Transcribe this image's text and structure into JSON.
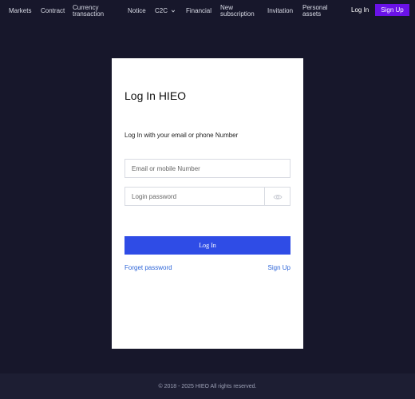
{
  "nav": {
    "items": [
      {
        "label": "Markets"
      },
      {
        "label": "Contract"
      },
      {
        "label": "Currency transaction"
      },
      {
        "label": "Notice"
      },
      {
        "label": "C2C"
      },
      {
        "label": "Financial"
      },
      {
        "label": "New subscription"
      },
      {
        "label": "Invitation"
      },
      {
        "label": "Personal assets"
      }
    ],
    "login": "Log In",
    "signup": "Sign Up"
  },
  "form": {
    "title": "Log In HIEO",
    "subtitle": "Log In with your email or phone Number",
    "email_placeholder": "Email or mobile Number",
    "password_placeholder": "Login password",
    "submit": "Log In",
    "forgot": "Forget password",
    "signup": "Sign Up"
  },
  "footer": {
    "copyright": "© 2018 - 2025 HIEO All rights reserved."
  },
  "colors": {
    "background": "#17172b",
    "accent_purple": "#6a12e8",
    "button_blue": "#2f4ce6",
    "link_blue": "#2f66d8"
  }
}
